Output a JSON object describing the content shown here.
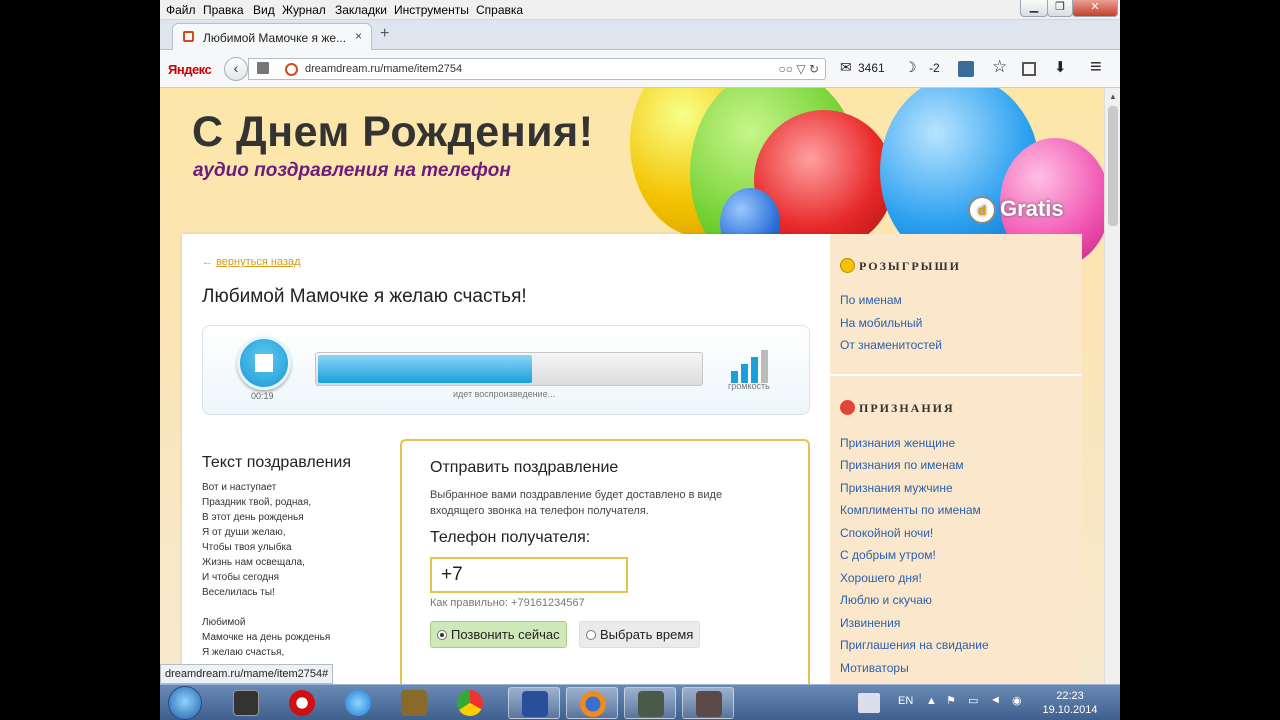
{
  "menubar": {
    "items": [
      "Файл",
      "Правка",
      "Вид",
      "Журнал",
      "Закладки",
      "Инструменты",
      "Справка"
    ]
  },
  "window_buttons": {
    "minimize": "▁",
    "maximize": "❐",
    "close": "✕"
  },
  "tab": {
    "title": "Любимой Мамочке я же...",
    "close": "×",
    "new_tab": "+"
  },
  "nav": {
    "yandex": "Яндекс",
    "back_glyph": "‹",
    "url": "dreamdream.ru/mame/item2754",
    "url_icons": "○○ ▽ ↻",
    "mail_count": "3461",
    "weather": "-2",
    "mail_glyph": "✉",
    "weather_glyph": "☽",
    "star_glyph": "☆",
    "download_glyph": "⬇",
    "menu_glyph": "≡"
  },
  "banner": {
    "title": "С Днем Рождения!",
    "subtitle": "аудио поздравления на телефон",
    "brand": "Gratis",
    "brand_logo": "d"
  },
  "content": {
    "back_arrow": "←",
    "back_link": "вернуться назад",
    "title": "Любимой Мамочке я желаю счастья!"
  },
  "player": {
    "time": "00:19",
    "progress": 0.56,
    "status": "идет воспроизведение...",
    "volume_label": "громкость",
    "volume_level": 0.8
  },
  "lyrics": {
    "heading": "Текст поздравления",
    "lines": [
      "Вот и наступает",
      "Праздник твой, родная,",
      "В этот день рожденья",
      "Я от души желаю,",
      "Чтобы твоя улыбка",
      "Жизнь нам освещала,",
      "И чтобы сегодня",
      "Веселилась ты!",
      "",
      "Любимой",
      "Мамочке на день рожденья",
      "Я желаю счастья,"
    ]
  },
  "send": {
    "heading": "Отправить поздравление",
    "description": "Выбранное вами поздравление будет доставлено в виде входящего звонка на телефон получателя.",
    "phone_label": "Телефон получателя:",
    "phone_value": "+7",
    "phone_hint": "Как правильно: +79161234567",
    "option_now": "Позвонить сейчас",
    "option_time": "Выбрать время"
  },
  "sidebar": {
    "pranks": {
      "heading": "РОЗЫГРЫШИ",
      "links": [
        "По именам",
        "На мобильный",
        "От знаменитостей"
      ]
    },
    "confessions": {
      "heading": "ПРИЗНАНИЯ",
      "links": [
        "Признания женщине",
        "Признания по именам",
        "Признания мужчине",
        "Комплименты по именам",
        "Спокойной ночи!",
        "С добрым утром!",
        "Хорошего дня!",
        "Люблю и скучаю",
        "Извинения",
        "Приглашения на свидание",
        "Мотиваторы"
      ]
    }
  },
  "status_url": "dreamdream.ru/mame/item2754#",
  "taskbar": {
    "lang": "EN",
    "time": "22:23",
    "date": "19.10.2014"
  },
  "colors": {
    "accent_blue": "#1a9fdb",
    "link_blue": "#2a5fae",
    "gold_border": "#e8c24d",
    "subtitle_purple": "#6d1b7c"
  }
}
